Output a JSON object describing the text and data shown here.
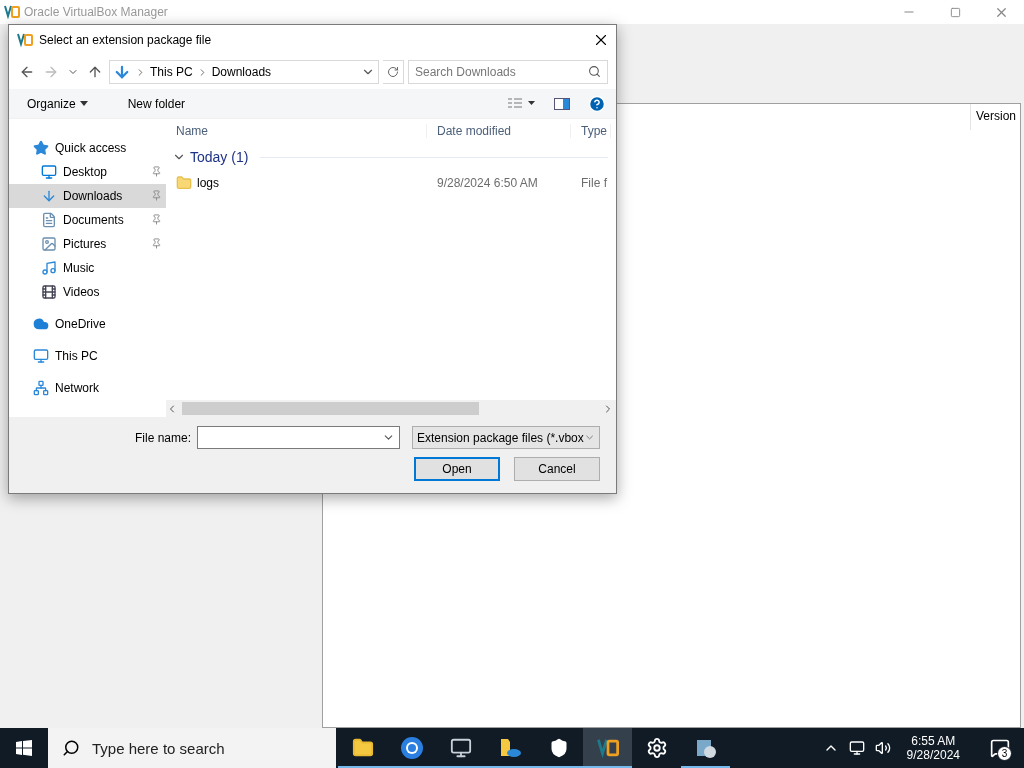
{
  "background_window": {
    "title": "Oracle VirtualBox Manager",
    "table_columns": [
      "Version"
    ]
  },
  "dialog": {
    "title": "Select an extension package file",
    "breadcrumb": [
      "This PC",
      "Downloads"
    ],
    "search": {
      "placeholder": "Search Downloads"
    },
    "toolbar": [
      "Organize",
      "New folder"
    ],
    "nav_pane": [
      {
        "label": "Quick access",
        "kind": "star",
        "selected": false,
        "children": [
          {
            "label": "Desktop",
            "kind": "desktop",
            "pinned": true,
            "selected": false
          },
          {
            "label": "Downloads",
            "kind": "download",
            "pinned": true,
            "selected": true
          },
          {
            "label": "Documents",
            "kind": "document",
            "pinned": true,
            "selected": false
          },
          {
            "label": "Pictures",
            "kind": "picture",
            "pinned": true,
            "selected": false
          },
          {
            "label": "Music",
            "kind": "music",
            "pinned": false,
            "selected": false
          },
          {
            "label": "Videos",
            "kind": "video",
            "pinned": false,
            "selected": false
          }
        ]
      },
      {
        "label": "OneDrive",
        "kind": "cloud",
        "selected": false
      },
      {
        "label": "This PC",
        "kind": "computer",
        "selected": false
      },
      {
        "label": "Network",
        "kind": "network",
        "selected": false
      }
    ],
    "columns": [
      "Name",
      "Date modified",
      "Type"
    ],
    "groups": [
      {
        "label": "Today (1)",
        "expanded": true,
        "files": [
          {
            "name": "logs",
            "date_modified": "9/28/2024 6:50 AM",
            "type": "File f",
            "selected": false
          }
        ]
      }
    ],
    "file_name": {
      "label": "File name:"
    },
    "file_type": "Extension package files (*.vbox",
    "buttons": [
      {
        "label": "Open",
        "default": true
      },
      {
        "label": "Cancel",
        "default": false
      }
    ]
  },
  "taskbar": {
    "search": {
      "placeholder": "Type here to search"
    },
    "apps": [
      {
        "kind": "folder",
        "running": true,
        "active": false
      },
      {
        "kind": "browser",
        "running": true,
        "active": false
      },
      {
        "kind": "monitor",
        "running": true,
        "active": false
      },
      {
        "kind": "cloudfolder",
        "running": true,
        "active": false
      },
      {
        "kind": "shield",
        "running": true,
        "active": false
      },
      {
        "kind": "vbox",
        "running": true,
        "active": true
      },
      {
        "kind": "gear",
        "running": false,
        "active": false
      },
      {
        "kind": "installer",
        "running": true,
        "active": false
      }
    ],
    "time": "6:55 AM",
    "date": "9/28/2024",
    "notifications": "3"
  }
}
